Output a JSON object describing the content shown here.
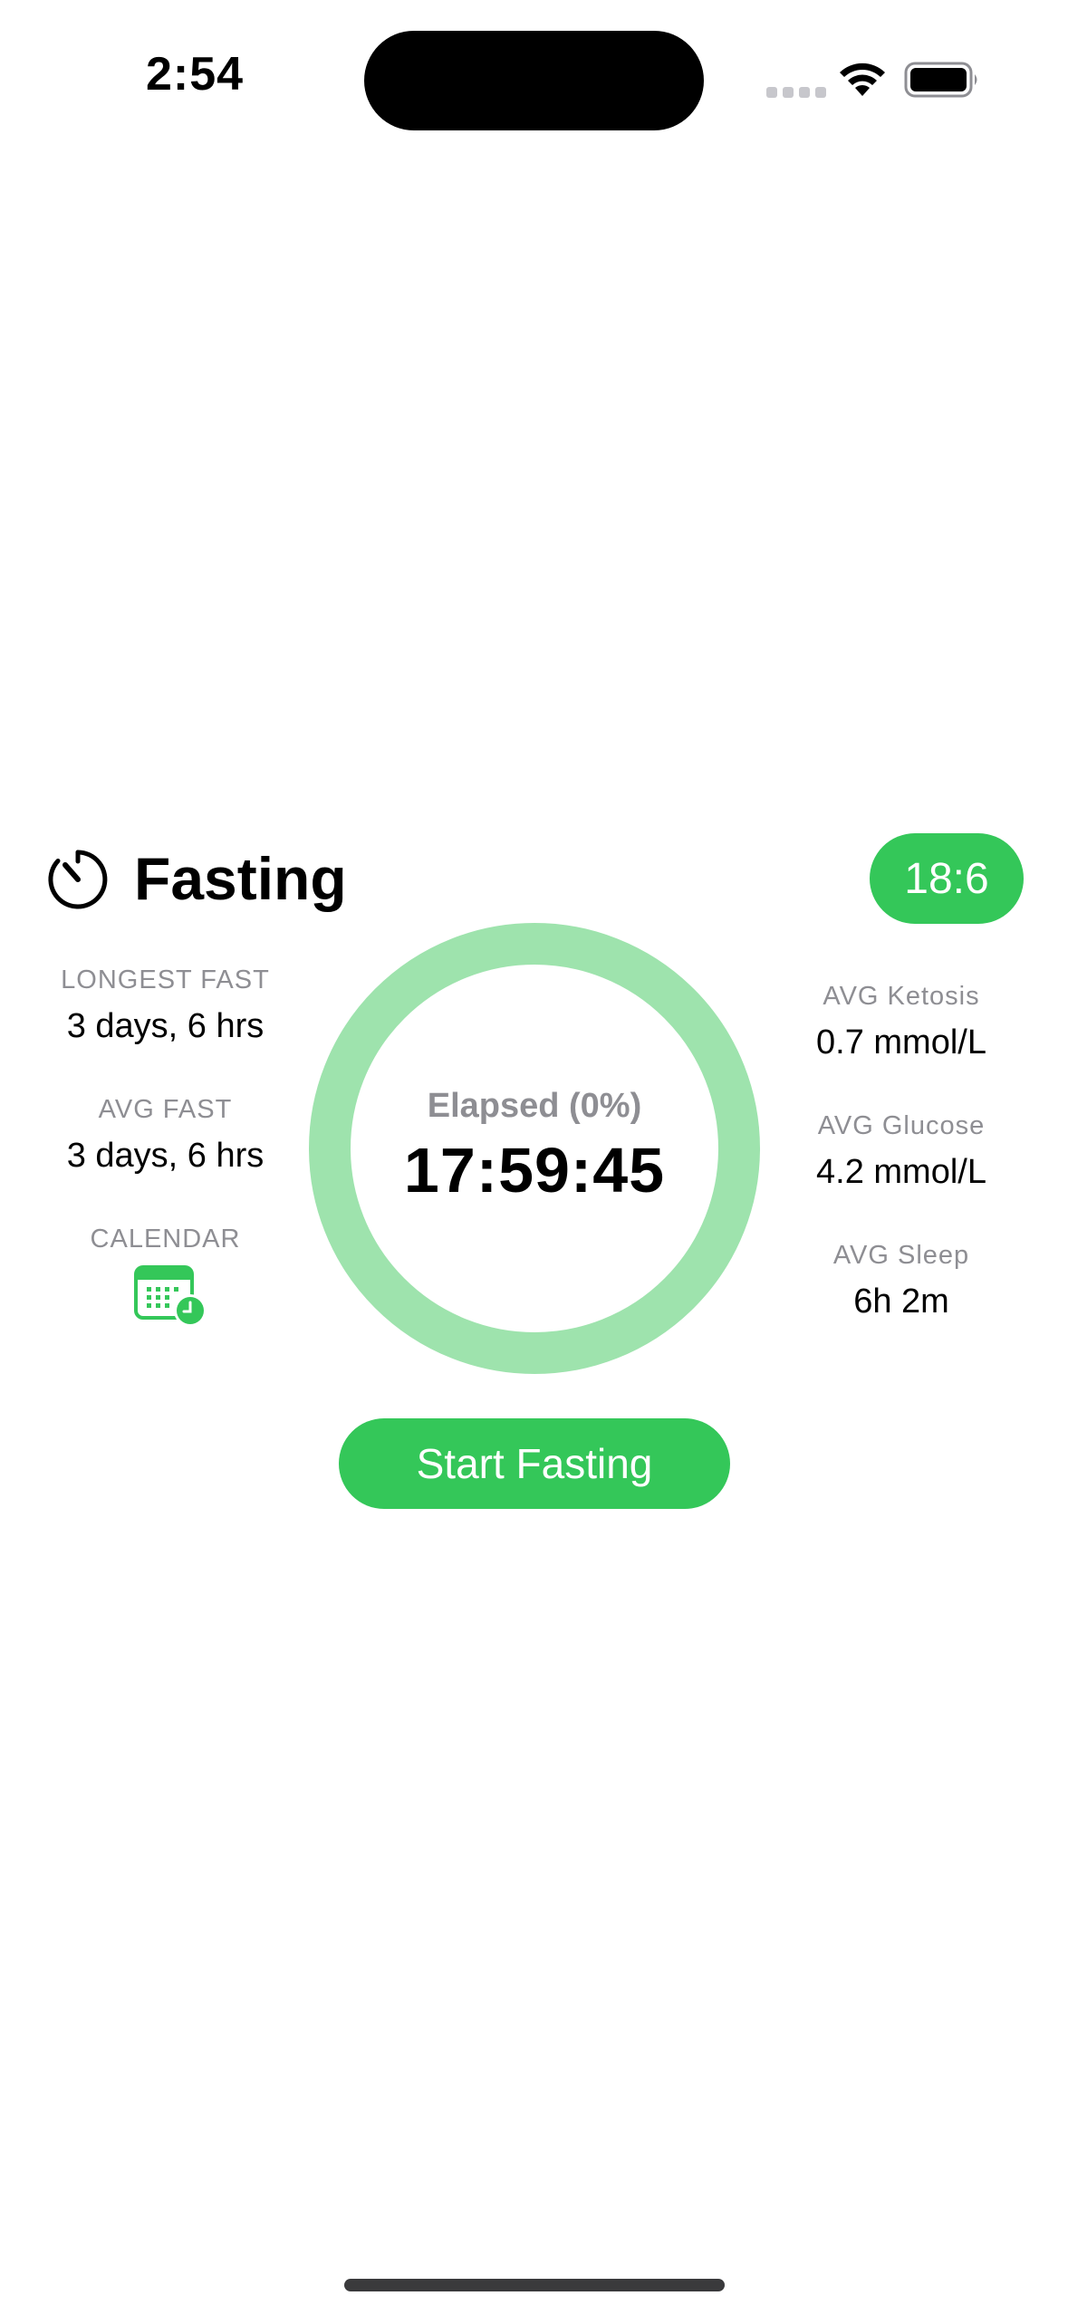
{
  "status_bar": {
    "time": "2:54"
  },
  "header": {
    "title": "Fasting",
    "plan": "18:6",
    "icon": "timer-icon"
  },
  "left_stats": {
    "longest_fast": {
      "label": "LONGEST FAST",
      "value": "3 days, 6 hrs"
    },
    "avg_fast": {
      "label": "AVG FAST",
      "value": "3 days, 6 hrs"
    },
    "calendar": {
      "label": "CALENDAR",
      "icon": "calendar-clock-icon"
    }
  },
  "right_stats": {
    "ketosis": {
      "label": "AVG Ketosis",
      "value": "0.7 mmol/L"
    },
    "glucose": {
      "label": "AVG Glucose",
      "value": "4.2 mmol/L"
    },
    "sleep": {
      "label": "AVG Sleep",
      "value": "6h 2m"
    }
  },
  "timer": {
    "elapsed_label": "Elapsed (0%)",
    "elapsed_time": "17:59:45",
    "progress": 0
  },
  "actions": {
    "start_label": "Start Fasting"
  },
  "colors": {
    "accent": "#34c759",
    "ring_track": "#9ee3ad",
    "secondary_text": "#8e8e93"
  }
}
